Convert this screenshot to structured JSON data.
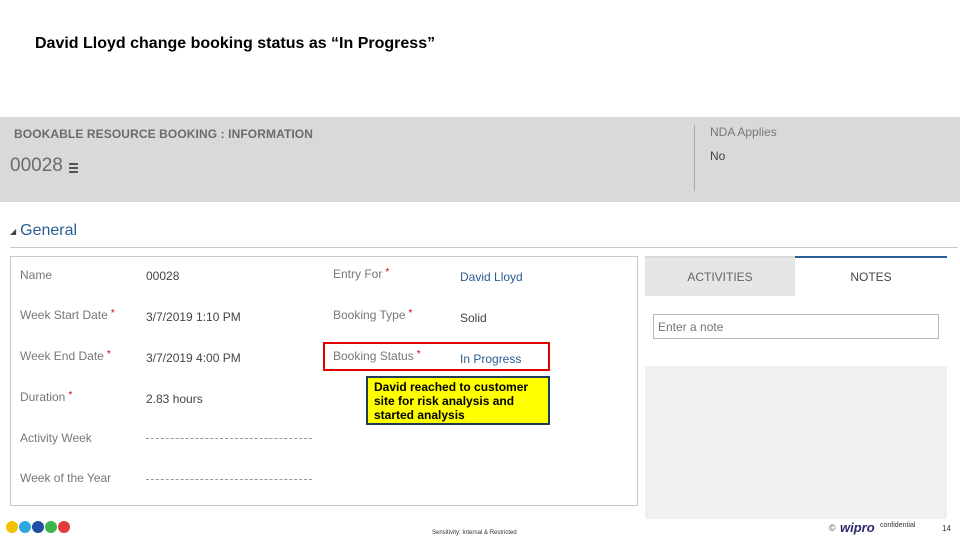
{
  "slide": {
    "title": "David Lloyd  change booking status as “In Progress”"
  },
  "header": {
    "entity_label": "BOOKABLE RESOURCE BOOKING : INFORMATION",
    "record_id": "00028",
    "nda_label": "NDA Applies",
    "nda_value": "No"
  },
  "section": {
    "title": "General"
  },
  "form": {
    "left_fields": [
      {
        "label": "Name",
        "required": "",
        "value": "00028"
      },
      {
        "label": "Week Start Date",
        "required": "*",
        "value": "3/7/2019  1:10 PM"
      },
      {
        "label": "Week End Date",
        "required": "*",
        "value": "3/7/2019  4:00 PM"
      },
      {
        "label": "Duration",
        "required": "*",
        "value": "2.83 hours"
      },
      {
        "label": "Activity Week",
        "required": "",
        "value": ""
      },
      {
        "label": "Week of the Year",
        "required": "",
        "value": ""
      }
    ],
    "right_fields": [
      {
        "label": "Entry For",
        "required": "*",
        "value": "David Lloyd"
      },
      {
        "label": "Booking Type",
        "required": "*",
        "value": "Solid"
      },
      {
        "label": "Booking Status",
        "required": "*",
        "value": "In Progress"
      }
    ]
  },
  "callout": {
    "text": "David reached to customer site for risk analysis and started analysis"
  },
  "side_panel": {
    "tabs": [
      {
        "label": "ACTIVITIES",
        "active": false
      },
      {
        "label": "NOTES",
        "active": true
      }
    ],
    "note_placeholder": "Enter a note"
  },
  "footer": {
    "dot_colors": [
      "#f2c200",
      "#2fa8e0",
      "#1f4fa3",
      "#3cb54a",
      "#e23b3b"
    ],
    "classification": "Sensitivity: Internal & Restricted",
    "copyright": "©",
    "logo": "wipro",
    "confidential": "confidential",
    "page": "14"
  },
  "colors": {
    "accent": "#2a5d94",
    "highlight_border": "#e00000",
    "callout_bg": "#ffff00",
    "header_band": "#d9d9d9"
  }
}
